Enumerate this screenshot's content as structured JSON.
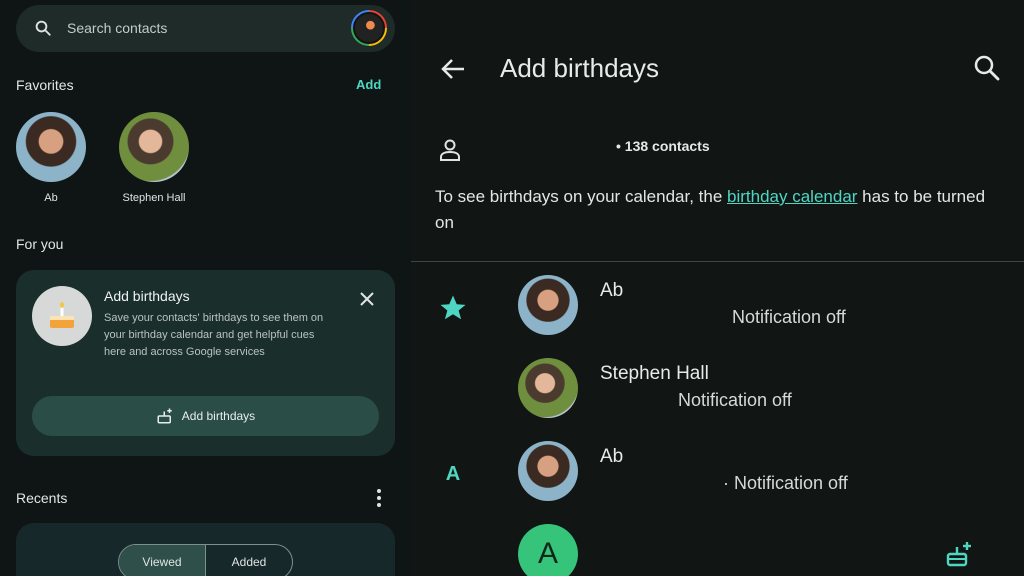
{
  "left": {
    "search": {
      "placeholder": "Search contacts"
    },
    "favorites": {
      "title": "Favorites",
      "add_label": "Add",
      "items": [
        {
          "name": "Ab"
        },
        {
          "name": "Stephen Hall"
        }
      ]
    },
    "for_you": {
      "title": "For you",
      "card": {
        "title": "Add birthdays",
        "description": "Save your contacts' birthdays to see them on your birthday calendar and get helpful cues here and across Google services",
        "button_label": "Add birthdays"
      }
    },
    "recents": {
      "title": "Recents",
      "segments": [
        "Viewed",
        "Added"
      ],
      "selected": "Viewed"
    }
  },
  "right": {
    "title": "Add birthdays",
    "account_contacts": "• 138 contacts",
    "info_prefix": "To see birthdays on your calendar, the ",
    "info_link": "birthday calendar",
    "info_suffix": " has to be turned on",
    "contacts": [
      {
        "lead": "star-icon",
        "name": "Ab",
        "status": "Notification off"
      },
      {
        "lead": "",
        "name": "Stephen Hall",
        "status": "Notification off"
      },
      {
        "lead": "A",
        "name": "Ab",
        "status": "· Notification off"
      },
      {
        "lead": "",
        "name": "",
        "avatar_letter": "A",
        "status": ""
      }
    ]
  },
  "colors": {
    "accent": "#4fd6c3",
    "background": "#0f1514",
    "card": "#1a2e2b"
  }
}
